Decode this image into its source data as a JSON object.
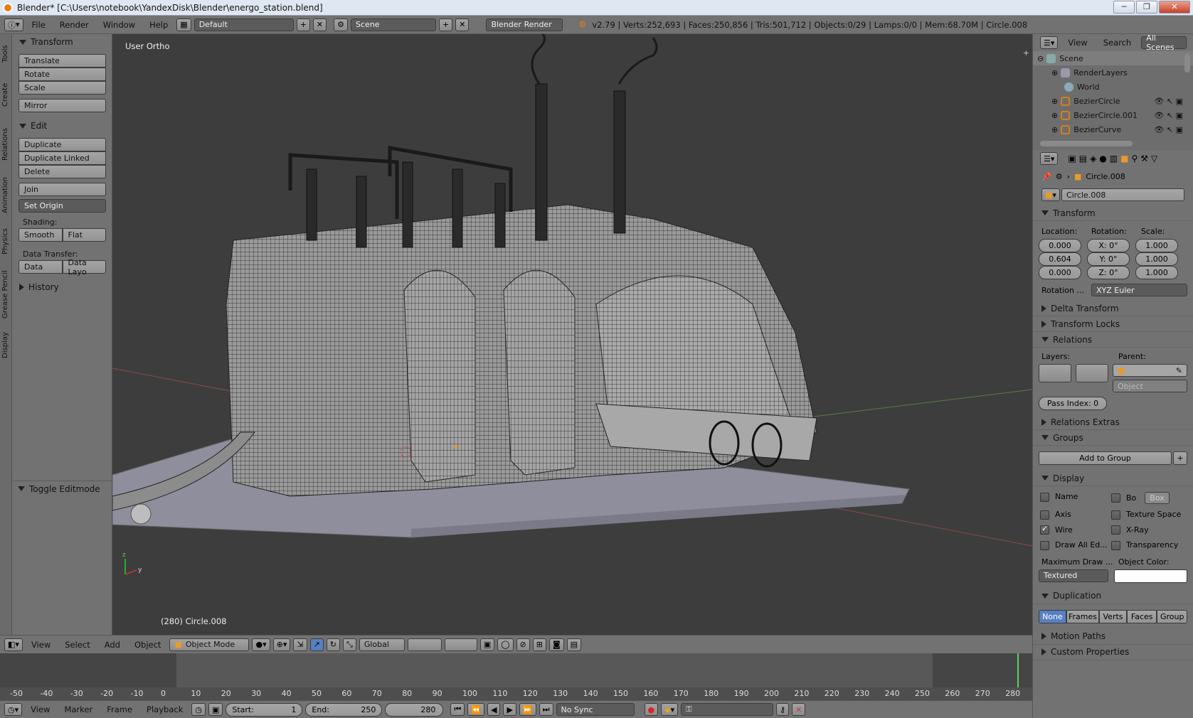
{
  "window": {
    "title": "Blender* [C:\\Users\\notebook\\YandexDisk\\Blender\\energo_station.blend]",
    "minimize": "─",
    "maximize": "❐",
    "close": "✕"
  },
  "infobar": {
    "menus": [
      "File",
      "Render",
      "Window",
      "Help"
    ],
    "layout": "Default",
    "scene": "Scene",
    "engine": "Blender Render",
    "stats": "v2.79 | Verts:252,693 | Faces:250,856 | Tris:501,712 | Objects:0/29 | Lamps:0/0 | Mem:68.70M | Circle.008"
  },
  "tooltabs": [
    "Tools",
    "Create",
    "Relations",
    "Animation",
    "Physics",
    "Grease Pencil",
    "Display"
  ],
  "toolshelf": {
    "transform_title": "Transform",
    "translate": "Translate",
    "rotate": "Rotate",
    "scale": "Scale",
    "mirror": "Mirror",
    "edit_title": "Edit",
    "duplicate": "Duplicate",
    "duplicate_linked": "Duplicate Linked",
    "delete": "Delete",
    "join": "Join",
    "set_origin": "Set Origin",
    "shading_label": "Shading:",
    "smooth": "Smooth",
    "flat": "Flat",
    "data_transfer_label": "Data Transfer:",
    "data": "Data",
    "data_layo": "Data Layo",
    "history_title": "History",
    "toggle_editmode": "Toggle Editmode"
  },
  "viewport": {
    "view_label": "User Ortho",
    "selection": "(280) Circle.008"
  },
  "vpheader": {
    "menus": [
      "View",
      "Select",
      "Add",
      "Object"
    ],
    "mode": "Object Mode",
    "orientation": "Global"
  },
  "timeline": {
    "ticks": [
      "-50",
      "-40",
      "-30",
      "-20",
      "-10",
      "0",
      "10",
      "20",
      "30",
      "40",
      "50",
      "60",
      "70",
      "80",
      "90",
      "100",
      "110",
      "120",
      "130",
      "140",
      "150",
      "160",
      "170",
      "180",
      "190",
      "200",
      "210",
      "220",
      "230",
      "240",
      "250",
      "260",
      "270",
      "280"
    ],
    "menus": [
      "View",
      "Marker",
      "Frame",
      "Playback"
    ],
    "start": "Start:",
    "start_val": "1",
    "end": "End:",
    "end_val": "250",
    "current": "280",
    "sync": "No Sync"
  },
  "outliner": {
    "view": "View",
    "search": "Search",
    "all_scenes": "All Scenes",
    "items": [
      "Scene",
      "RenderLayers",
      "World",
      "BezierCircle",
      "BezierCircle.001",
      "BezierCurve"
    ]
  },
  "props": {
    "object_name": "Circle.008",
    "name_field": "Circle.008",
    "transform": "Transform",
    "location": "Location:",
    "rotation": "Rotation:",
    "scale": "Scale:",
    "loc": [
      "0.000",
      "0.604",
      "0.000"
    ],
    "rot": [
      "X:  0°",
      "Y:  0°",
      "Z:  0°"
    ],
    "scl": [
      "1.000",
      "1.000",
      "1.000"
    ],
    "rotation_mode_label": "Rotation ...",
    "rotation_mode": "XYZ Euler",
    "delta": "Delta Transform",
    "locks": "Transform Locks",
    "relations": "Relations",
    "layers": "Layers:",
    "parent": "Parent:",
    "parent_type": "Object",
    "pass_index": "Pass Index:  0",
    "relations_extras": "Relations Extras",
    "groups": "Groups",
    "add_to_group": "Add to Group",
    "display": "Display",
    "name": "Name",
    "bo": "Bo",
    "box": "Box",
    "axis": "Axis",
    "texture_space": "Texture Space",
    "wire": "Wire",
    "xray": "X-Ray",
    "draw_all": "Draw All Ed...",
    "transparency": "Transparency",
    "max_draw": "Maximum Draw ...",
    "object_color": "Object Color:",
    "textured": "Textured",
    "duplication": "Duplication",
    "dup_opts": [
      "None",
      "Frames",
      "Verts",
      "Faces",
      "Group"
    ],
    "motion_paths": "Motion Paths",
    "custom_props": "Custom Properties"
  }
}
